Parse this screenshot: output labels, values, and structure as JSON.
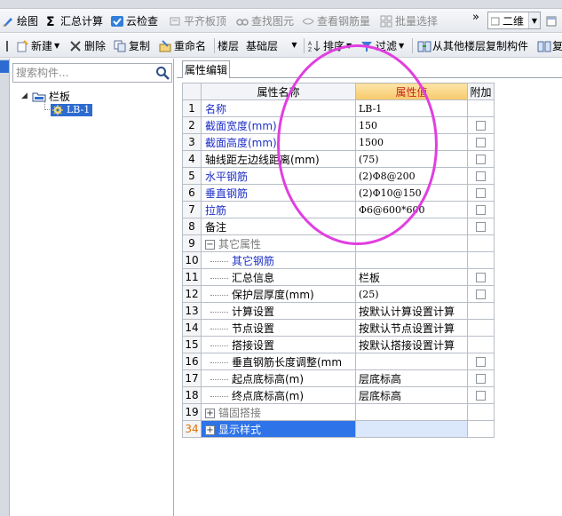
{
  "toolbar1": {
    "items": [
      {
        "label": "绘图",
        "icon": "draw-icon"
      },
      {
        "label": "汇总计算",
        "icon": "sigma-icon"
      },
      {
        "label": "云检查",
        "icon": "cloud-check-icon"
      },
      {
        "label": "平齐板顶",
        "icon": "align-slab-icon"
      },
      {
        "label": "查找图元",
        "icon": "find-icon"
      },
      {
        "label": "查看钢筋量",
        "icon": "rebar-view-icon"
      },
      {
        "label": "批量选择",
        "icon": "batch-select-icon"
      }
    ],
    "more": "»",
    "view_combo": "二维"
  },
  "toolbar2": {
    "new_label": "新建",
    "delete_label": "删除",
    "copy_label": "复制",
    "rename_label": "重命名",
    "floor_label": "楼层",
    "floor_value": "基础层",
    "sort_label": "排序",
    "filter_label": "过滤",
    "copy_from_floor_label": "从其他楼层复制构件",
    "extra_label": "复"
  },
  "left": {
    "search_placeholder": "搜索构件...",
    "tree_root": "栏板",
    "tree_child": "LB-1"
  },
  "panel_tab": "属性编辑",
  "grid": {
    "headers": {
      "name": "属性名称",
      "value": "属性值",
      "add": "附加"
    },
    "rows": [
      {
        "num": "1",
        "name": "名称",
        "value": "LB-1",
        "blue": true,
        "checkbox": false
      },
      {
        "num": "2",
        "name": "截面宽度(mm)",
        "value": "150",
        "blue": true,
        "checkbox": true
      },
      {
        "num": "3",
        "name": "截面高度(mm)",
        "value": "1500",
        "blue": true,
        "checkbox": true
      },
      {
        "num": "4",
        "name": "轴线距左边线距离(mm)",
        "value": "(75)",
        "blue": false,
        "checkbox": true
      },
      {
        "num": "5",
        "name": "水平钢筋",
        "value": "(2)Φ8@200",
        "blue": true,
        "checkbox": true
      },
      {
        "num": "6",
        "name": "垂直钢筋",
        "value": "(2)Φ10@150",
        "blue": true,
        "checkbox": true
      },
      {
        "num": "7",
        "name": "拉筋",
        "value": "Φ6@600*600",
        "blue": true,
        "checkbox": true
      },
      {
        "num": "8",
        "name": "备注",
        "value": "",
        "blue": false,
        "checkbox": true
      },
      {
        "num": "9",
        "name": "其它属性",
        "value": "",
        "group": true,
        "expander": "−",
        "checkbox": false
      },
      {
        "num": "10",
        "name": "其它钢筋",
        "value": "",
        "sub": true,
        "blue": true,
        "checkbox": false
      },
      {
        "num": "11",
        "name": "汇总信息",
        "value": "栏板",
        "sub": true,
        "checkbox": true
      },
      {
        "num": "12",
        "name": "保护层厚度(mm)",
        "value": "(25)",
        "sub": true,
        "checkbox": true
      },
      {
        "num": "13",
        "name": "计算设置",
        "value": "按默认计算设置计算",
        "sub": true,
        "checkbox": false
      },
      {
        "num": "14",
        "name": "节点设置",
        "value": "按默认节点设置计算",
        "sub": true,
        "checkbox": false
      },
      {
        "num": "15",
        "name": "搭接设置",
        "value": "按默认搭接设置计算",
        "sub": true,
        "checkbox": false
      },
      {
        "num": "16",
        "name": "垂直钢筋长度调整(mm",
        "value": "",
        "sub": true,
        "checkbox": true
      },
      {
        "num": "17",
        "name": "起点底标高(m)",
        "value": "层底标高",
        "sub": true,
        "checkbox": true
      },
      {
        "num": "18",
        "name": "终点底标高(m)",
        "value": "层底标高",
        "sub": true,
        "checkbox": true
      },
      {
        "num": "19",
        "name": "锚固搭接",
        "value": "",
        "group": true,
        "expander": "+",
        "checkbox": false
      },
      {
        "num": "34",
        "name": "显示样式",
        "value": "",
        "group": true,
        "expander": "+",
        "selected": true,
        "checkbox": false
      }
    ]
  },
  "colors": {
    "accent": "#2e73e8",
    "header_highlight": "#f7c96a",
    "annotation_circle": "#e03fe0",
    "label_blue": "#1d2fc7"
  }
}
